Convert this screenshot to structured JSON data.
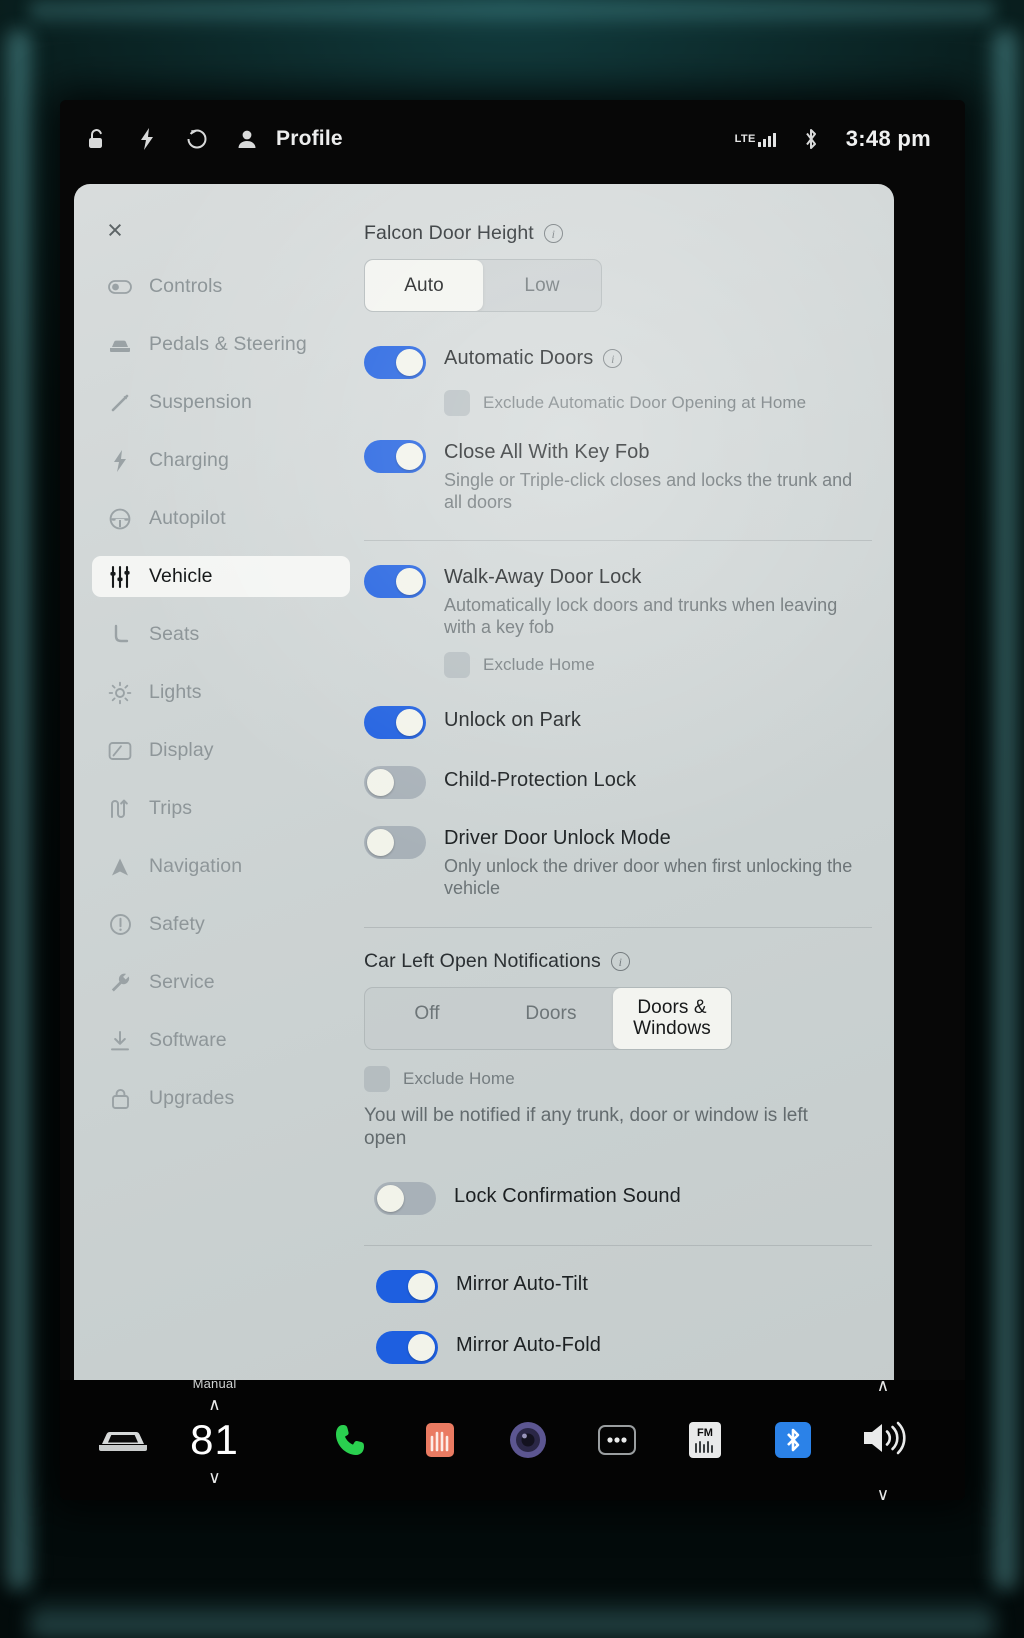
{
  "status_bar": {
    "icons": [
      "lock-icon",
      "charging-bolt-icon",
      "home-icon",
      "person-icon"
    ],
    "profile_label": "Profile",
    "network_label": "LTE",
    "bluetooth_icon": "bluetooth-icon",
    "clock": "3:48 pm"
  },
  "panel": {
    "close_label": "×",
    "sidebar": [
      {
        "label": "Controls",
        "icon": "toggle-icon",
        "active": false
      },
      {
        "label": "Pedals & Steering",
        "icon": "car-front-icon",
        "active": false
      },
      {
        "label": "Suspension",
        "icon": "suspension-icon",
        "active": false
      },
      {
        "label": "Charging",
        "icon": "bolt-icon",
        "active": false
      },
      {
        "label": "Autopilot",
        "icon": "steering-wheel-icon",
        "active": false
      },
      {
        "label": "Vehicle",
        "icon": "sliders-icon",
        "active": true
      },
      {
        "label": "Seats",
        "icon": "seat-icon",
        "active": false
      },
      {
        "label": "Lights",
        "icon": "sun-icon",
        "active": false
      },
      {
        "label": "Display",
        "icon": "screen-icon",
        "active": false
      },
      {
        "label": "Trips",
        "icon": "route-icon",
        "active": false
      },
      {
        "label": "Navigation",
        "icon": "navigation-arrow-icon",
        "active": false
      },
      {
        "label": "Safety",
        "icon": "alert-circle-icon",
        "active": false
      },
      {
        "label": "Service",
        "icon": "wrench-icon",
        "active": false
      },
      {
        "label": "Software",
        "icon": "download-icon",
        "active": false
      },
      {
        "label": "Upgrades",
        "icon": "bag-icon",
        "active": false
      }
    ],
    "sections": {
      "falcon_door_height": {
        "title": "Falcon Door Height",
        "options": [
          "Auto",
          "Low"
        ],
        "selected": "Auto"
      },
      "automatic_doors": {
        "label": "Automatic Doors",
        "state": "on",
        "checkbox_label": "Exclude Automatic Door Opening at Home",
        "checkbox_checked": false
      },
      "close_all_with_key_fob": {
        "label": "Close All With Key Fob",
        "description": "Single or Triple-click closes and locks the trunk and all doors",
        "state": "on"
      },
      "walk_away_door_lock": {
        "label": "Walk-Away Door Lock",
        "description": "Automatically lock doors and trunks when leaving with a key fob",
        "state": "on",
        "checkbox_label": "Exclude Home",
        "checkbox_checked": false
      },
      "unlock_on_park": {
        "label": "Unlock on Park",
        "state": "on"
      },
      "child_protection_lock": {
        "label": "Child-Protection Lock",
        "state": "off"
      },
      "driver_door_unlock_mode": {
        "label": "Driver Door Unlock Mode",
        "description": "Only unlock the driver door when first unlocking the vehicle",
        "state": "off"
      },
      "car_left_open_notifications": {
        "title": "Car Left Open Notifications",
        "options": [
          "Off",
          "Doors",
          "Doors & Windows"
        ],
        "selected": "Doors & Windows",
        "checkbox_label": "Exclude Home",
        "checkbox_checked": false,
        "description": "You will be notified if any trunk, door or window is left open"
      },
      "lock_confirmation_sound": {
        "label": "Lock Confirmation Sound",
        "state": "off"
      },
      "mirror_auto_tilt": {
        "label": "Mirror Auto-Tilt",
        "state": "on"
      },
      "mirror_auto_fold": {
        "label": "Mirror Auto-Fold",
        "state": "on"
      }
    }
  },
  "app_bar": {
    "car_icon": "car-icon",
    "climate_mode": "Manual",
    "climate_up": "∧",
    "temperature": "81",
    "climate_down": "∨",
    "apps": [
      {
        "name": "phone-icon",
        "color": "#2ad04f"
      },
      {
        "name": "seat-heater-icon",
        "color": "#ea7b62"
      },
      {
        "name": "camera-icon",
        "color": "#6b63a8"
      },
      {
        "name": "more-dots-icon",
        "color": "#e9eaea"
      },
      {
        "name": "fm-radio-icon",
        "color": "#e9eaea"
      },
      {
        "name": "bluetooth-app-icon",
        "color": "#2b82e8"
      }
    ],
    "volume_icon": "volume-icon",
    "volume_up": "∧",
    "volume_down": "∨"
  }
}
